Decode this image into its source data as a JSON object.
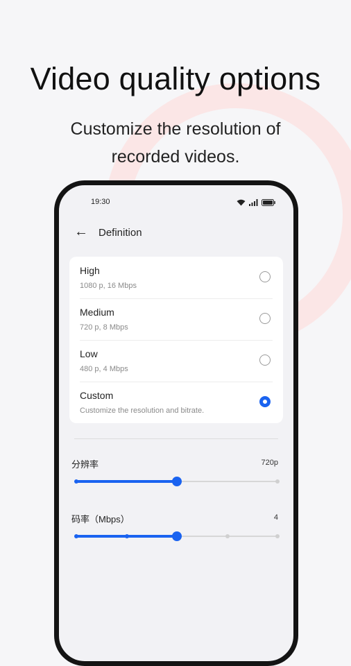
{
  "promo": {
    "headline": "Video quality options",
    "subline": "Customize the resolution of recorded videos."
  },
  "statusbar": {
    "time": "19:30",
    "icons": [
      "wifi-icon",
      "signal-icon",
      "battery-icon"
    ]
  },
  "nav": {
    "title": "Definition",
    "back_icon": "back-arrow-icon"
  },
  "options": [
    {
      "name": "High",
      "detail": "1080 p, 16 Mbps",
      "selected": false
    },
    {
      "name": "Medium",
      "detail": "720 p, 8 Mbps",
      "selected": false
    },
    {
      "name": "Low",
      "detail": "480 p, 4 Mbps",
      "selected": false
    },
    {
      "name": "Custom",
      "detail": "Customize the resolution and bitrate.",
      "selected": true
    }
  ],
  "resolution": {
    "label": "分辨率",
    "value": "720p",
    "level": 0.5,
    "steps": 3
  },
  "bitrate": {
    "label": "码率（Mbps）",
    "value": "4",
    "level": 0.5,
    "steps": 5
  },
  "colors": {
    "accent": "#1a63f0",
    "ring": "#fbe3e3",
    "background": "#f6f6f8"
  }
}
